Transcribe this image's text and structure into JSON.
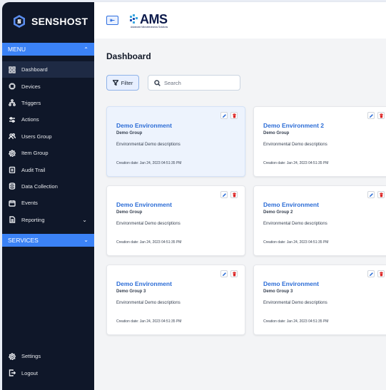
{
  "brand": {
    "name": "SENSHOST",
    "logo_icon": "hexagon-s-icon",
    "accent": "#3b82f6"
  },
  "header": {
    "toggle_icon": "sidebar-collapse-icon",
    "company_logo": "AMS",
    "company_subtitle": "Advanced Microelectronics Solutions"
  },
  "sidebar": {
    "menu_label": "MENU",
    "services_label": "SERVICES",
    "items": [
      {
        "label": "Dashboard",
        "icon": "grid-icon"
      },
      {
        "label": "Devices",
        "icon": "chip-icon"
      },
      {
        "label": "Triggers",
        "icon": "flow-icon"
      },
      {
        "label": "Actions",
        "icon": "sliders-icon"
      },
      {
        "label": "Users Group",
        "icon": "users-icon"
      },
      {
        "label": "Item Group",
        "icon": "gear-icon"
      },
      {
        "label": "Audit Trail",
        "icon": "clipboard-icon"
      },
      {
        "label": "Data Collection",
        "icon": "database-icon"
      },
      {
        "label": "Events",
        "icon": "calendar-icon"
      },
      {
        "label": "Reporting",
        "icon": "report-icon"
      }
    ],
    "bottom": [
      {
        "label": "Settings",
        "icon": "gear-icon"
      },
      {
        "label": "Logout",
        "icon": "logout-icon"
      }
    ]
  },
  "main": {
    "title": "Dashboard",
    "filter_label": "Filter",
    "search_placeholder": "Search",
    "cards": [
      {
        "title": "Demo Environment",
        "group": "Demo Group",
        "description": "Environmental Demo descriptions",
        "date": "Creation date: Jan 24, 2023 04:51:35 PM"
      },
      {
        "title": "Demo Environment 2",
        "group": "Demo Group",
        "description": "Environmental Demo descriptions",
        "date": "Creation date: Jan 24, 2023 04:51:35 PM"
      },
      {
        "title": "Demo Environment",
        "group": "Demo Group",
        "description": "Environmental Demo descriptions",
        "date": "Creation date: Jan 24, 2023 04:51:35 PM"
      },
      {
        "title": "Demo Environment",
        "group": "Demo Group 2",
        "description": "Environmental Demo descriptions",
        "date": "Creation date: Jan 24, 2023 04:51:35 PM"
      },
      {
        "title": "Demo Environment",
        "group": "Demo Group 3",
        "description": "Environmental Demo descriptions",
        "date": "Creation date: Jan 24, 2023 04:51:35 PM"
      },
      {
        "title": "Demo Environment",
        "group": "Demo Group 3",
        "description": "Environmental Demo descriptions",
        "date": "Creation date: Jan 24, 2023 04:51:35 PM"
      }
    ]
  },
  "colors": {
    "sidebar_bg": "#0f1729",
    "link_blue": "#2b6cd6",
    "delete_red": "#dc2626"
  }
}
